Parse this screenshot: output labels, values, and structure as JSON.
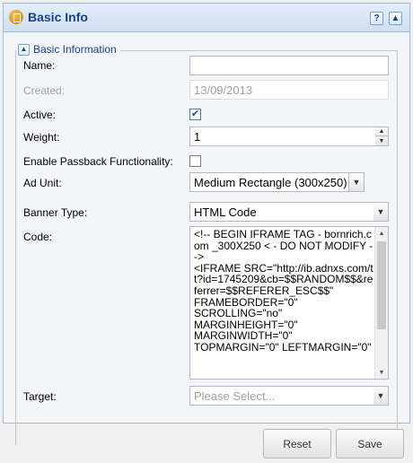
{
  "panel": {
    "title": "Basic Info",
    "help_label": "?",
    "collapse_label": "▲"
  },
  "fieldset": {
    "legend": "Basic Information",
    "collapse_label": "▲"
  },
  "form": {
    "name": {
      "label": "Name:",
      "value": ""
    },
    "created": {
      "label": "Created:",
      "value": "13/09/2013"
    },
    "active": {
      "label": "Active:",
      "checked": true,
      "mark": "✔"
    },
    "weight": {
      "label": "Weight:",
      "value": "1"
    },
    "passback": {
      "label": "Enable Passback Functionality:",
      "checked": false,
      "mark": ""
    },
    "ad_unit": {
      "label": "Ad Unit:",
      "value": "Medium Rectangle (300x250)"
    },
    "banner_type": {
      "label": "Banner Type:",
      "value": "HTML Code"
    },
    "code": {
      "label": "Code:",
      "value": "<!-- BEGIN IFRAME TAG - bornrich.com _300X250 < - DO NOT MODIFY -->\n<IFRAME SRC=\"http://ib.adnxs.com/tt?id=1745209&cb=$$RANDOM$$&referrer=$$REFERER_ESC$$\"\nFRAMEBORDER=\"0\"\nSCROLLING=\"no\"\nMARGINHEIGHT=\"0\"\nMARGINWIDTH=\"0\"\nTOPMARGIN=\"0\" LEFTMARGIN=\"0\""
    },
    "target": {
      "label": "Target:",
      "placeholder": "Please Select..."
    }
  },
  "buttons": {
    "reset": "Reset",
    "save": "Save"
  },
  "colors": {
    "header_text": "#15428b",
    "panel_border": "#99bbe8",
    "field_border": "#b5b8c8"
  }
}
